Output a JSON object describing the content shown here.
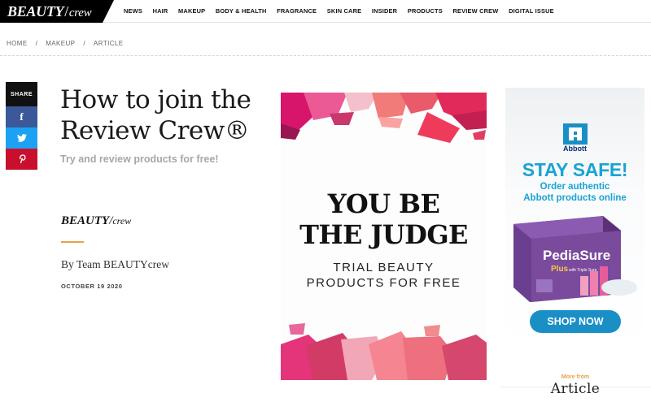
{
  "header": {
    "logo_main": "BEAUTY",
    "logo_slash": "/",
    "logo_crew": "crew",
    "nav": [
      "NEWS",
      "HAIR",
      "MAKEUP",
      "BODY & HEALTH",
      "FRAGRANCE",
      "SKIN CARE",
      "INSIDER",
      "PRODUCTS",
      "REVIEW CREW",
      "DIGITAL ISSUE"
    ]
  },
  "breadcrumb": {
    "items": [
      "HOME",
      "MAKEUP",
      "ARTICLE"
    ],
    "separator": "/"
  },
  "share": {
    "label": "SHARE",
    "buttons": [
      {
        "icon": "facebook-icon",
        "glyph": "f"
      },
      {
        "icon": "twitter-icon"
      },
      {
        "icon": "pinterest-icon"
      }
    ],
    "colors": {
      "facebook": "#3b5998",
      "twitter": "#1da1f2",
      "pinterest": "#c8102e"
    }
  },
  "article": {
    "title": "How to join the Review Crew®",
    "subtitle": "Try and review products for free!",
    "author_logo_main": "BEAUTY",
    "author_logo_slash": "/",
    "author_logo_crew": "crew",
    "byline": "By Team BEAUTYcrew",
    "date": "OCTOBER 19 2020"
  },
  "hero": {
    "headline_line1": "YOU BE",
    "headline_line2": "THE JUDGE",
    "sub_line1": "TRIAL BEAUTY",
    "sub_line2": "PRODUCTS FOR FREE"
  },
  "ad": {
    "brand": "Abbott",
    "headline": "STAY SAFE!",
    "line1": "Order authentic",
    "line2": "Abbott products online",
    "product": "PediaSure",
    "product_sub": "Plus",
    "product_tag": "with Triple Sure",
    "cta": "SHOP NOW",
    "colors": {
      "accent": "#1aa3d4",
      "button": "#1a8fc6",
      "box": "#7a4b9c"
    }
  },
  "more_from": {
    "label": "More from",
    "title": "Article"
  },
  "colors": {
    "accent": "#e8a04a",
    "text": "#1a1a1a",
    "muted": "#a7a7a7"
  }
}
